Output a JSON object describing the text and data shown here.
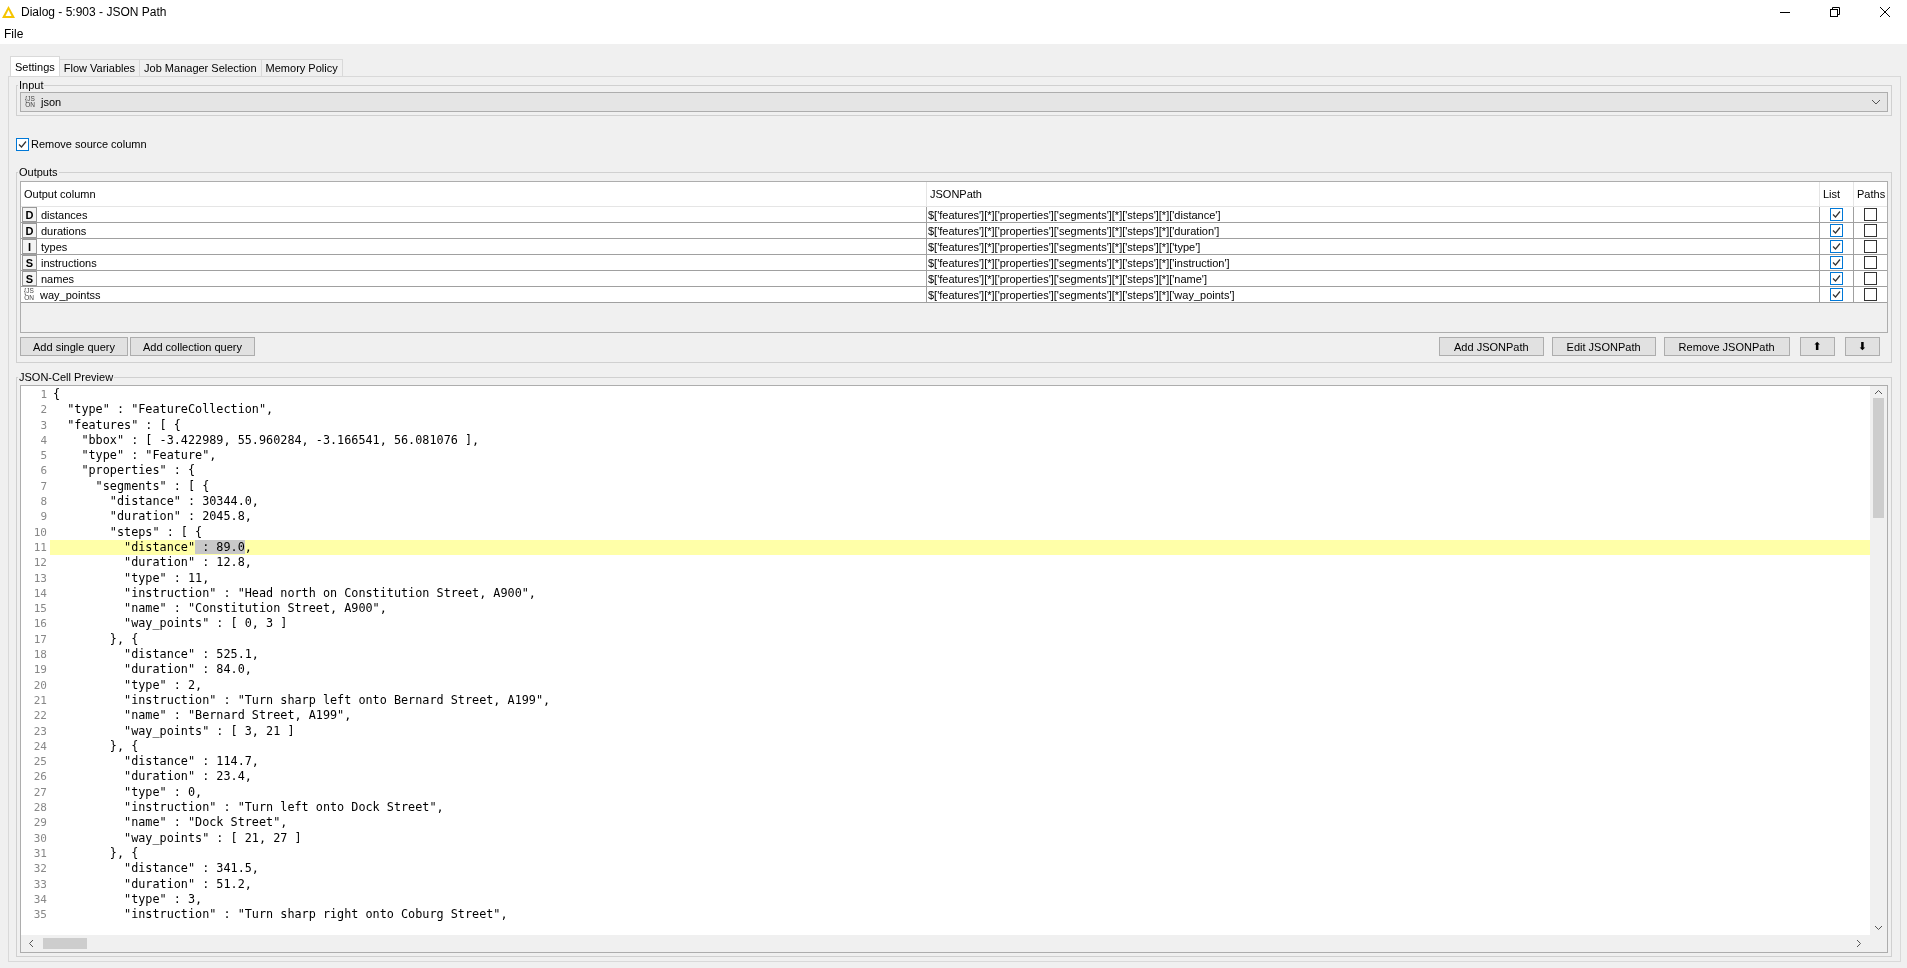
{
  "window": {
    "title": "Dialog - 5:903 - JSON Path"
  },
  "menu": [
    "File"
  ],
  "tabs": [
    {
      "label": "Settings",
      "selected": true
    },
    {
      "label": "Flow Variables",
      "selected": false
    },
    {
      "label": "Job Manager Selection",
      "selected": false
    },
    {
      "label": "Memory Policy",
      "selected": false
    }
  ],
  "input": {
    "label": "Input",
    "column": {
      "type_label": "{JS ON",
      "name": "json"
    }
  },
  "remove_source": {
    "label": "Remove source column",
    "checked": true
  },
  "outputs": {
    "label": "Outputs",
    "columns": [
      "Output column",
      "JSONPath",
      "List",
      "Paths"
    ],
    "rows": [
      {
        "kind": "letter",
        "type_label": "D",
        "name": "distances",
        "path": "$['features'][*]['properties']['segments'][*]['steps'][*]['distance']",
        "list": true,
        "paths": false
      },
      {
        "kind": "letter",
        "type_label": "D",
        "name": "durations",
        "path": "$['features'][*]['properties']['segments'][*]['steps'][*]['duration']",
        "list": true,
        "paths": false
      },
      {
        "kind": "letter",
        "type_label": "I",
        "name": "types",
        "path": "$['features'][*]['properties']['segments'][*]['steps'][*]['type']",
        "list": true,
        "paths": false
      },
      {
        "kind": "letter",
        "type_label": "S",
        "name": "instructions",
        "path": "$['features'][*]['properties']['segments'][*]['steps'][*]['instruction']",
        "list": true,
        "paths": false
      },
      {
        "kind": "letter",
        "type_label": "S",
        "name": "names",
        "path": "$['features'][*]['properties']['segments'][*]['steps'][*]['name']",
        "list": true,
        "paths": false
      },
      {
        "kind": "json",
        "type_label": "{JS ON",
        "name": "way_pointss",
        "path": "$['features'][*]['properties']['segments'][*]['steps'][*]['way_points']",
        "list": true,
        "paths": false
      }
    ],
    "left_buttons": [
      "Add single query",
      "Add collection query"
    ],
    "right_buttons": [
      "Add JSONPath",
      "Edit JSONPath",
      "Remove JSONPath",
      "⬆",
      "⬇"
    ]
  },
  "preview": {
    "label": "JSON-Cell Preview",
    "lines": [
      {
        "number": "1",
        "text": "{"
      },
      {
        "number": "2",
        "text": "  \"type\" : \"FeatureCollection\","
      },
      {
        "number": "3",
        "text": "  \"features\" : [ {"
      },
      {
        "number": "4",
        "text": "    \"bbox\" : [ -3.422989, 55.960284, -3.166541, 56.081076 ],"
      },
      {
        "number": "5",
        "text": "    \"type\" : \"Feature\","
      },
      {
        "number": "6",
        "text": "    \"properties\" : {"
      },
      {
        "number": "7",
        "text": "      \"segments\" : [ {"
      },
      {
        "number": "8",
        "text": "        \"distance\" : 30344.0,"
      },
      {
        "number": "9",
        "text": "        \"duration\" : 2045.8,"
      },
      {
        "number": "10",
        "text": "        \"steps\" : [ {"
      },
      {
        "number": "11",
        "highlighted": true,
        "parts": [
          {
            "text": "          \"distance\"",
            "selected": false
          },
          {
            "text": " : 89.0",
            "selected": true
          },
          {
            "text": ",",
            "selected": false
          }
        ]
      },
      {
        "number": "12",
        "text": "          \"duration\" : 12.8,"
      },
      {
        "number": "13",
        "text": "          \"type\" : 11,"
      },
      {
        "number": "14",
        "text": "          \"instruction\" : \"Head north on Constitution Street, A900\","
      },
      {
        "number": "15",
        "text": "          \"name\" : \"Constitution Street, A900\","
      },
      {
        "number": "16",
        "text": "          \"way_points\" : [ 0, 3 ]"
      },
      {
        "number": "17",
        "text": "        }, {"
      },
      {
        "number": "18",
        "text": "          \"distance\" : 525.1,"
      },
      {
        "number": "19",
        "text": "          \"duration\" : 84.0,"
      },
      {
        "number": "20",
        "text": "          \"type\" : 2,"
      },
      {
        "number": "21",
        "text": "          \"instruction\" : \"Turn sharp left onto Bernard Street, A199\","
      },
      {
        "number": "22",
        "text": "          \"name\" : \"Bernard Street, A199\","
      },
      {
        "number": "23",
        "text": "          \"way_points\" : [ 3, 21 ]"
      },
      {
        "number": "24",
        "text": "        }, {"
      },
      {
        "number": "25",
        "text": "          \"distance\" : 114.7,"
      },
      {
        "number": "26",
        "text": "          \"duration\" : 23.4,"
      },
      {
        "number": "27",
        "text": "          \"type\" : 0,"
      },
      {
        "number": "28",
        "text": "          \"instruction\" : \"Turn left onto Dock Street\","
      },
      {
        "number": "29",
        "text": "          \"name\" : \"Dock Street\","
      },
      {
        "number": "30",
        "text": "          \"way_points\" : [ 21, 27 ]"
      },
      {
        "number": "31",
        "text": "        }, {"
      },
      {
        "number": "32",
        "text": "          \"distance\" : 341.5,"
      },
      {
        "number": "33",
        "text": "          \"duration\" : 51.2,"
      },
      {
        "number": "34",
        "text": "          \"type\" : 3,"
      },
      {
        "number": "35",
        "text": "          \"instruction\" : \"Turn sharp right onto Coburg Street\","
      }
    ]
  }
}
